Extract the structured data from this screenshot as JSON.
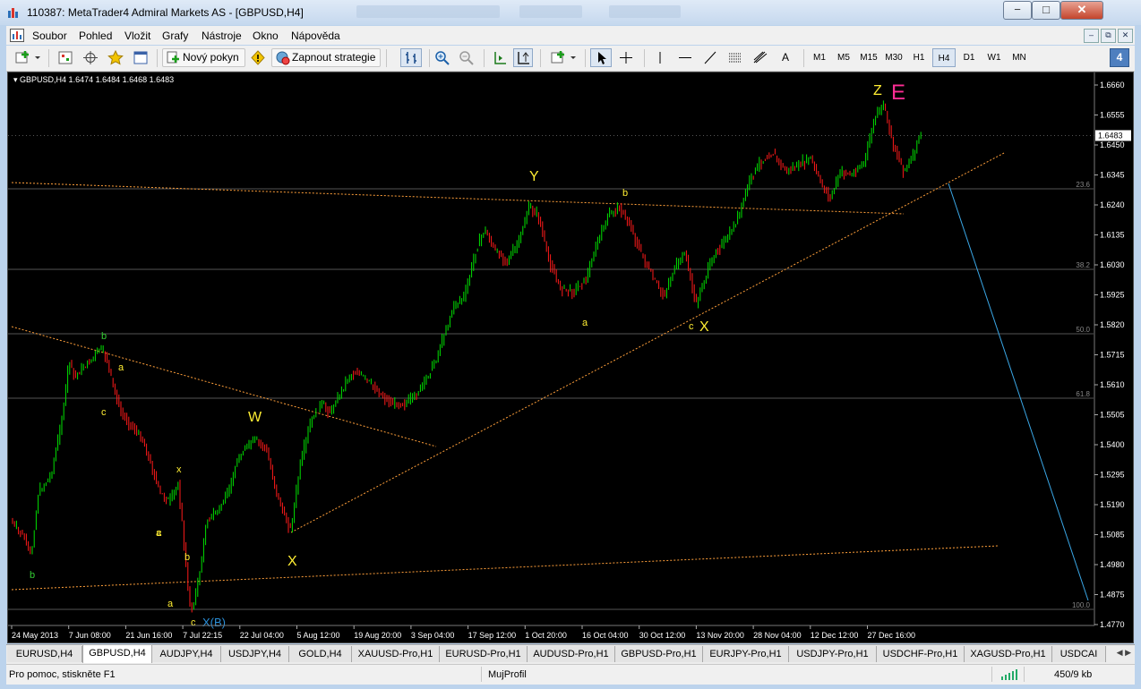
{
  "window": {
    "title": "110387: MetaTrader4 Admiral Markets AS - [GBPUSD,H4]",
    "controls": {
      "minimize": "−",
      "maximize": "□",
      "close": "✕"
    }
  },
  "menu": {
    "items": [
      "Soubor",
      "Pohled",
      "Vložit",
      "Grafy",
      "Nástroje",
      "Okno",
      "Nápověda"
    ],
    "mdi": {
      "minimize": "–",
      "restore": "⧉",
      "close": "✕"
    }
  },
  "toolbar": {
    "new_order": "Nový pokyn",
    "autotrading": "Zapnout strategie",
    "timeframes": [
      "M1",
      "M5",
      "M15",
      "M30",
      "H1",
      "H4",
      "D1",
      "W1",
      "MN"
    ],
    "active_timeframe": "H4",
    "draw_text_tool": "A",
    "badge": "4"
  },
  "chart": {
    "header": "GBPUSD,H4  1.6474 1.6484 1.6468 1.6483",
    "symbol": "GBPUSD",
    "timeframe": "H4",
    "ohlc": {
      "open": 1.6474,
      "high": 1.6484,
      "low": 1.6468,
      "close": 1.6483
    },
    "current_price": "1.6483",
    "price_axis": [
      "1.6660",
      "1.6555",
      "1.6450",
      "1.6345",
      "1.6240",
      "1.6135",
      "1.6030",
      "1.5925",
      "1.5820",
      "1.5715",
      "1.5610",
      "1.5505",
      "1.5400",
      "1.5295",
      "1.5190",
      "1.5085",
      "1.4980",
      "1.4875",
      "1.4770"
    ],
    "time_axis": [
      "24 May 2013",
      "7 Jun 08:00",
      "21 Jun 16:00",
      "7 Jul 22:15",
      "22 Jul 04:00",
      "5 Aug 12:00",
      "19 Aug 20:00",
      "3 Sep 04:00",
      "17 Sep 12:00",
      "1 Oct 20:00",
      "16 Oct 04:00",
      "30 Oct 12:00",
      "13 Nov 20:00",
      "28 Nov 04:00",
      "12 Dec 12:00",
      "27 Dec 16:00"
    ],
    "fibo_levels": [
      "23.6",
      "38.2",
      "50.0",
      "61.8",
      "100.0"
    ],
    "wave_labels": [
      "b",
      "a",
      "c",
      "b",
      "a",
      "c",
      "x",
      "c",
      "b",
      "a",
      "X(B)",
      "W",
      "X",
      "Y",
      "a",
      "b",
      "c",
      "X",
      "Z",
      "E"
    ],
    "colors": {
      "bull": "#00e000",
      "bear": "#ff1a1a",
      "label_yellow": "#ffee33",
      "label_green": "#33cc33",
      "label_pink": "#ff2d95",
      "label_blue": "#2a8fd8",
      "trend": "#ff9f3a",
      "fibo": "#a0a0a0",
      "projection": "#3aa7e6"
    }
  },
  "tabs": {
    "items": [
      "EURUSD,H4",
      "GBPUSD,H4",
      "AUDJPY,H4",
      "USDJPY,H4",
      "GOLD,H4",
      "XAUUSD-Pro,H1",
      "EURUSD-Pro,H1",
      "AUDUSD-Pro,H1",
      "GBPUSD-Pro,H1",
      "EURJPY-Pro,H1",
      "USDJPY-Pro,H1",
      "USDCHF-Pro,H1",
      "XAGUSD-Pro,H1",
      "USDCAI"
    ],
    "active": "GBPUSD,H4"
  },
  "status": {
    "help": "Pro pomoc, stiskněte F1",
    "profile": "MujProfil",
    "traffic": "450/9 kb"
  }
}
